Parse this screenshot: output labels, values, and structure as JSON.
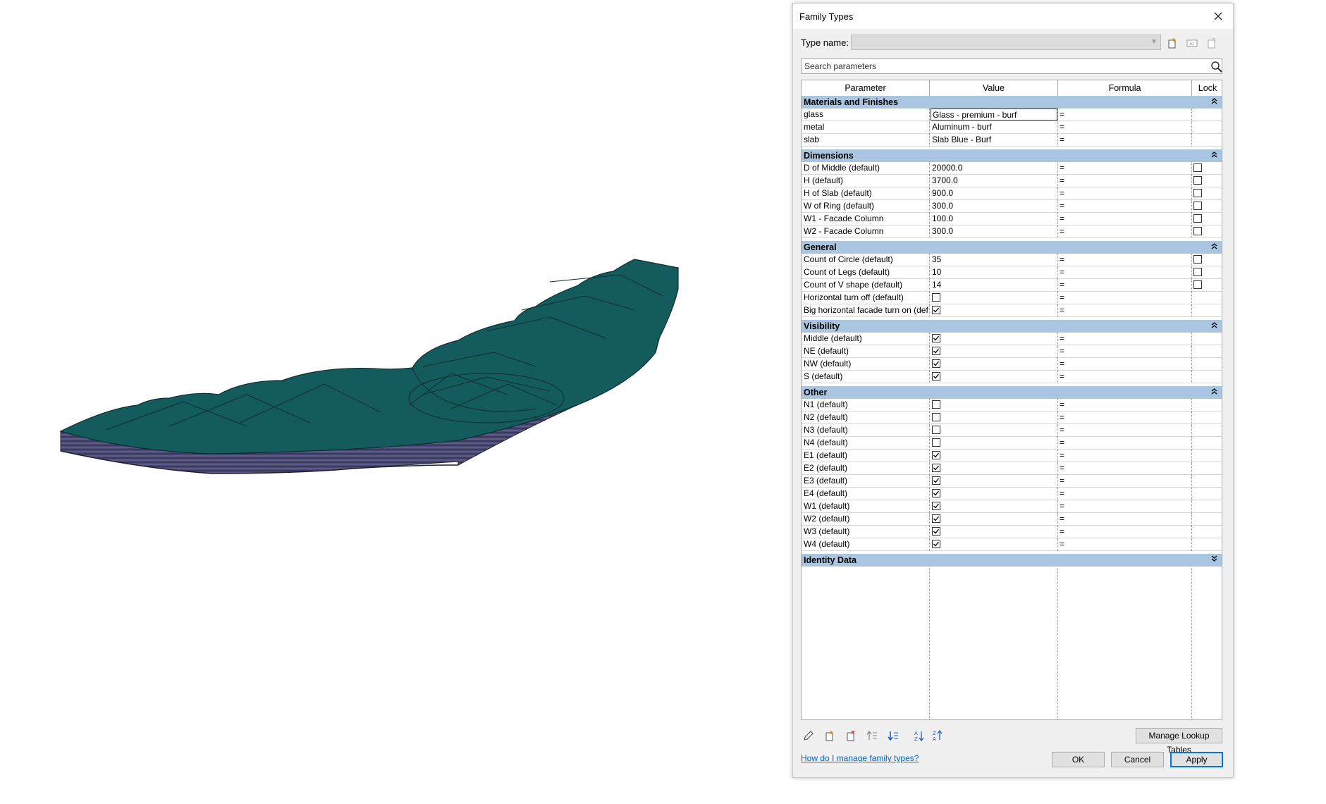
{
  "dialog": {
    "title": "Family Types",
    "type_name_label": "Type name:",
    "type_name_value": "",
    "search_placeholder": "Search parameters",
    "columns": [
      "Parameter",
      "Value",
      "Formula",
      "Lock"
    ],
    "groups": [
      {
        "name": "Materials and Finishes",
        "expanded": true,
        "rows": [
          {
            "param": "glass",
            "value": "Glass - premium - burf",
            "formula": "=",
            "editing": true
          },
          {
            "param": "metal",
            "value": "Aluminum - burf",
            "formula": "="
          },
          {
            "param": "slab",
            "value": "Slab Blue - Burf",
            "formula": "="
          }
        ]
      },
      {
        "name": "Dimensions",
        "expanded": true,
        "rows": [
          {
            "param": "D of Middle (default)",
            "value": "20000.0",
            "formula": "=",
            "lock": false
          },
          {
            "param": "H (default)",
            "value": "3700.0",
            "formula": "=",
            "lock": false
          },
          {
            "param": "H of Slab (default)",
            "value": "900.0",
            "formula": "=",
            "lock": false
          },
          {
            "param": "W of Ring (default)",
            "value": "300.0",
            "formula": "=",
            "lock": false
          },
          {
            "param": "W1 - Facade Column",
            "value": "100.0",
            "formula": "=",
            "lock": false
          },
          {
            "param": "W2 - Facade Column",
            "value": "300.0",
            "formula": "=",
            "lock": false
          }
        ]
      },
      {
        "name": "General",
        "expanded": true,
        "rows": [
          {
            "param": "Count of Circle (default)",
            "value": "35",
            "formula": "=",
            "lock": false
          },
          {
            "param": "Count of Legs (default)",
            "value": "10",
            "formula": "=",
            "lock": false
          },
          {
            "param": "Count of V shape (default)",
            "value": "14",
            "formula": "=",
            "lock": false
          },
          {
            "param": "Horizontal turn off (default)",
            "check": false,
            "formula": "="
          },
          {
            "param": "Big horizontal facade turn on (def",
            "check": true,
            "formula": "="
          }
        ]
      },
      {
        "name": "Visibility",
        "expanded": true,
        "rows": [
          {
            "param": "Middle (default)",
            "check": true,
            "formula": "="
          },
          {
            "param": "NE (default)",
            "check": true,
            "formula": "="
          },
          {
            "param": "NW (default)",
            "check": true,
            "formula": "="
          },
          {
            "param": "S (default)",
            "check": true,
            "formula": "="
          }
        ]
      },
      {
        "name": "Other",
        "expanded": true,
        "rows": [
          {
            "param": "N1 (default)",
            "check": false,
            "formula": "="
          },
          {
            "param": "N2 (default)",
            "check": false,
            "formula": "="
          },
          {
            "param": "N3 (default)",
            "check": false,
            "formula": "="
          },
          {
            "param": "N4 (default)",
            "check": false,
            "formula": "="
          },
          {
            "param": "E1 (default)",
            "check": true,
            "formula": "="
          },
          {
            "param": "E2 (default)",
            "check": true,
            "formula": "="
          },
          {
            "param": "E3 (default)",
            "check": true,
            "formula": "="
          },
          {
            "param": "E4 (default)",
            "check": true,
            "formula": "="
          },
          {
            "param": "W1 (default)",
            "check": true,
            "formula": "="
          },
          {
            "param": "W2 (default)",
            "check": true,
            "formula": "="
          },
          {
            "param": "W3 (default)",
            "check": true,
            "formula": "="
          },
          {
            "param": "W4 (default)",
            "check": true,
            "formula": "="
          }
        ]
      },
      {
        "name": "Identity Data",
        "expanded": false,
        "rows": []
      }
    ],
    "help_link": "How do I manage family types?",
    "manage_lookup_label": "Manage Lookup Tables",
    "ok_label": "OK",
    "cancel_label": "Cancel",
    "apply_label": "Apply"
  },
  "colors": {
    "model_top": "#145b5d",
    "model_side": "#4b4a76",
    "group_header": "#a9c5df"
  },
  "icons": [
    "close-icon",
    "new-type-icon",
    "rename-type-icon",
    "delete-type-icon",
    "search-icon",
    "edit-parameter-icon",
    "new-parameter-icon",
    "delete-parameter-icon",
    "move-up-icon",
    "move-down-icon",
    "sort-ascending-icon",
    "sort-descending-icon",
    "chevron-up-icon",
    "chevron-down-icon"
  ]
}
